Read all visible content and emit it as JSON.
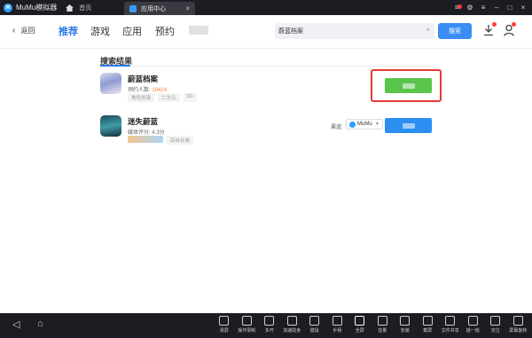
{
  "titlebar": {
    "app_name": "MuMu模拟器",
    "home_label": "首页",
    "active_tab_label": "应用中心",
    "tab_close": "×",
    "controls": [
      "✉",
      "⚙",
      "≡",
      "–",
      "□",
      "×"
    ]
  },
  "navbar": {
    "back_label": "返回",
    "tabs": [
      "推荐",
      "游戏",
      "应用",
      "预约"
    ],
    "search_value": "蔚蓝档案",
    "search_clear": "×",
    "search_button": "搜索"
  },
  "results": {
    "title": "搜索结果",
    "apps": [
      {
        "name": "蔚蓝档案",
        "meta_label": "预约人数:",
        "meta_value": "18424",
        "tags": [
          "角色扮演",
          "二次元",
          "3D"
        ]
      },
      {
        "name": "迷失蔚蓝",
        "meta_label": "媒体评分:",
        "meta_value": "4.3分",
        "tags": [
          "后台在装"
        ],
        "channel_label": "渠道:",
        "channel_value": "MuMu"
      }
    ]
  },
  "bottombar": {
    "nav_controls": [
      "◁",
      "⌂"
    ],
    "tools": [
      "录屏",
      "操作录制",
      "多开",
      "加速隐身",
      "键鼠",
      "手柄",
      "全屏",
      "音量",
      "安装",
      "截屏",
      "文件共享",
      "摇一摇",
      "定位",
      "屏幕旋转"
    ]
  },
  "colors": {
    "primary_blue": "#2e7be8",
    "download_green": "#5ac54c",
    "highlight_red": "#e53935",
    "titlebar_bg": "#1c1d22"
  }
}
